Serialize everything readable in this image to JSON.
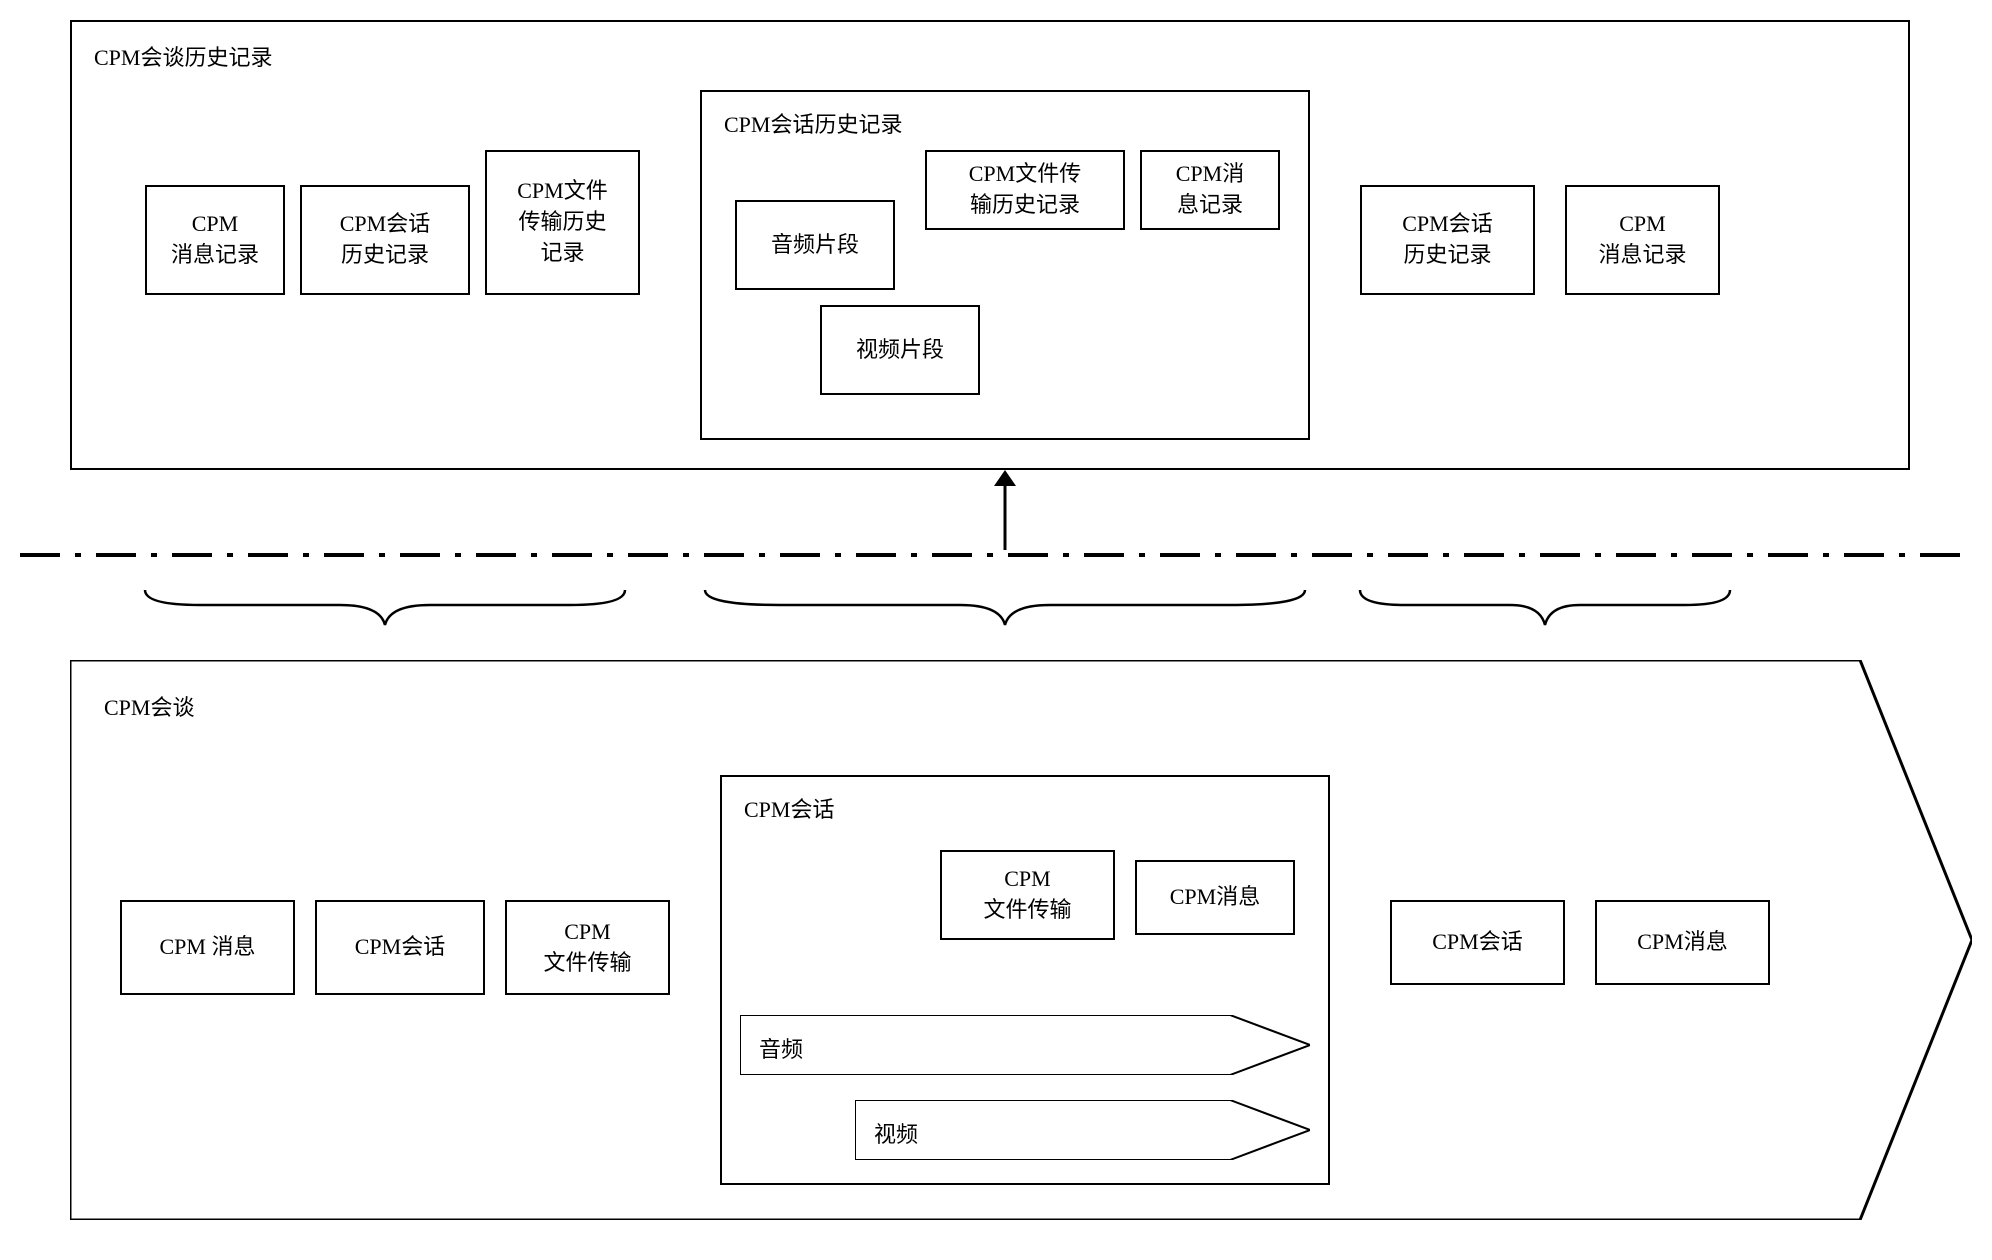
{
  "top": {
    "title": "CPM会谈历史记录",
    "left_group": {
      "msg": "CPM\n消息记录",
      "session_hist": "CPM会话\n历史记录",
      "file_hist": "CPM文件\n传输历史\n记录"
    },
    "mid_group": {
      "title": "CPM会话历史记录",
      "file_hist": "CPM文件传\n输历史记录",
      "msg": "CPM消\n息记录",
      "audio": "音频片段",
      "video": "视频片段"
    },
    "right_group": {
      "session_hist": "CPM会话\n历史记录",
      "msg": "CPM\n消息记录"
    }
  },
  "bottom": {
    "title": "CPM会谈",
    "left_group": {
      "msg": "CPM 消息",
      "session": "CPM会话",
      "file": "CPM\n文件传输"
    },
    "mid_group": {
      "title": "CPM会话",
      "file": "CPM\n文件传输",
      "msg": "CPM消息",
      "audio": "音频",
      "video": "视频"
    },
    "right_group": {
      "session": "CPM会话",
      "msg": "CPM消息"
    }
  }
}
